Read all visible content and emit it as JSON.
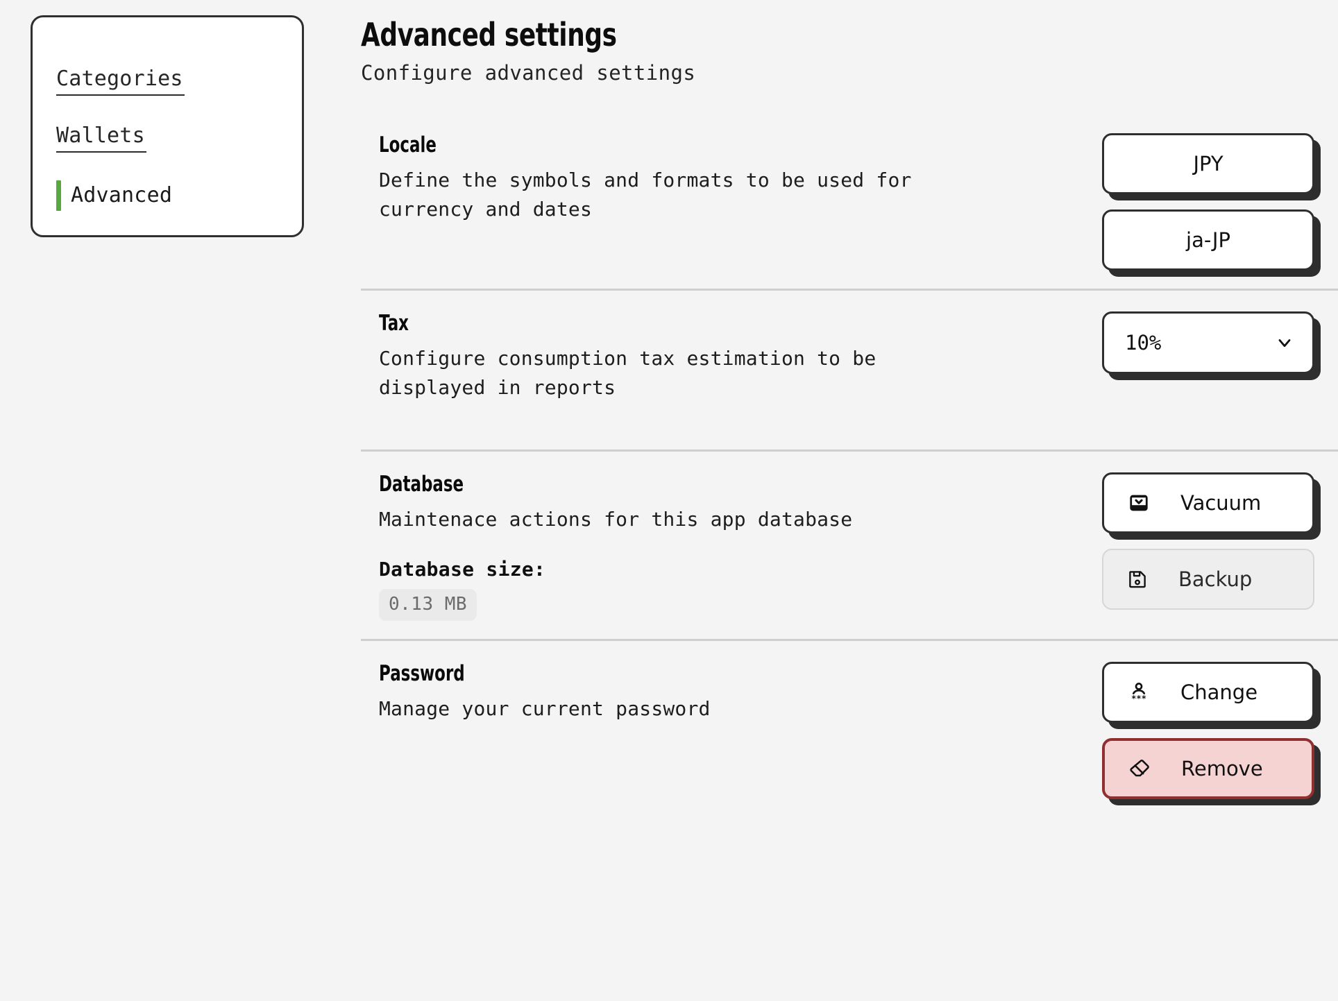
{
  "sidebar": {
    "items": [
      {
        "label": "Categories",
        "active": false,
        "icon": "none"
      },
      {
        "label": "Wallets",
        "active": false,
        "icon": "none"
      },
      {
        "label": "Advanced",
        "active": true,
        "icon": "active-accent-bar"
      }
    ],
    "accent_color": "#57a83f"
  },
  "header": {
    "title": "Advanced settings",
    "subtitle": "Configure advanced settings"
  },
  "sections": {
    "locale": {
      "title": "Locale",
      "description": "Define the symbols and formats to be used for currency and dates",
      "currency_button": "JPY",
      "locale_button": "ja-JP"
    },
    "tax": {
      "title": "Tax",
      "description": "Configure consumption tax estimation to be displayed in reports",
      "select_value": "10%",
      "select_icon": "chevron-down-icon",
      "options": [
        "10%"
      ]
    },
    "database": {
      "title": "Database",
      "description": "Maintenace actions for this app database",
      "size_label": "Database size:",
      "size_value": "0.13 MB",
      "vacuum_button": "Vacuum",
      "vacuum_icon": "archive-icon",
      "backup_button": "Backup",
      "backup_icon": "save-floppy-icon",
      "backup_disabled": true
    },
    "password": {
      "title": "Password",
      "description": "Manage your current password",
      "change_button": "Change",
      "change_icon": "user-password-icon",
      "remove_button": "Remove",
      "remove_icon": "eraser-icon",
      "remove_color": "#8f2f2f",
      "remove_background": "#f6d3d3"
    }
  },
  "colors": {
    "page_background": "#f4f4f4",
    "border": "#2e2e2e",
    "divider": "#cfcfcf",
    "accent_green": "#57a83f",
    "danger": "#8f2f2f",
    "chip_background": "#eaeaea",
    "disabled_background": "#eeeeee"
  }
}
